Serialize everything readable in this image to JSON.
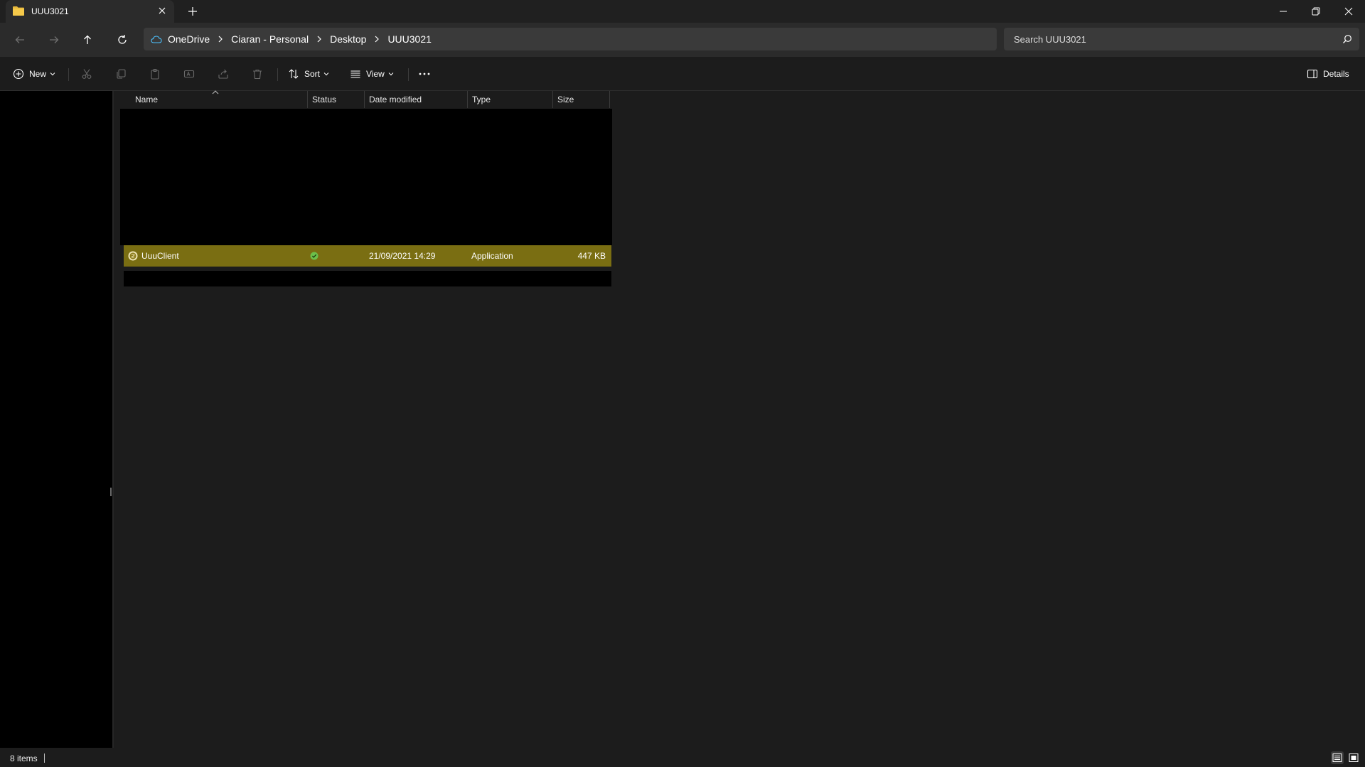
{
  "window": {
    "tab_title": "UUU3021"
  },
  "address_bar": {
    "breadcrumbs": [
      "OneDrive",
      "Ciaran - Personal",
      "Desktop",
      "UUU3021"
    ]
  },
  "search": {
    "placeholder": "Search UUU3021"
  },
  "command_bar": {
    "new_label": "New",
    "sort_label": "Sort",
    "view_label": "View",
    "details_label": "Details"
  },
  "file_list": {
    "columns": [
      "Name",
      "Status",
      "Date modified",
      "Type",
      "Size"
    ],
    "rows": [
      {
        "name": "UuuClient",
        "status": "synced",
        "date_modified": "21/09/2021 14:29",
        "type": "Application",
        "size": "447 KB",
        "selected": true
      }
    ]
  },
  "status_bar": {
    "item_count": "8 items"
  },
  "colors": {
    "selection": "#7a6e12",
    "folder": "#e8b93c",
    "status_synced": "#6cc04a",
    "accent": "#4cc2ff"
  },
  "icons": {
    "tab": "folder-icon",
    "row": "application-icon",
    "status": "synced-check-icon"
  }
}
